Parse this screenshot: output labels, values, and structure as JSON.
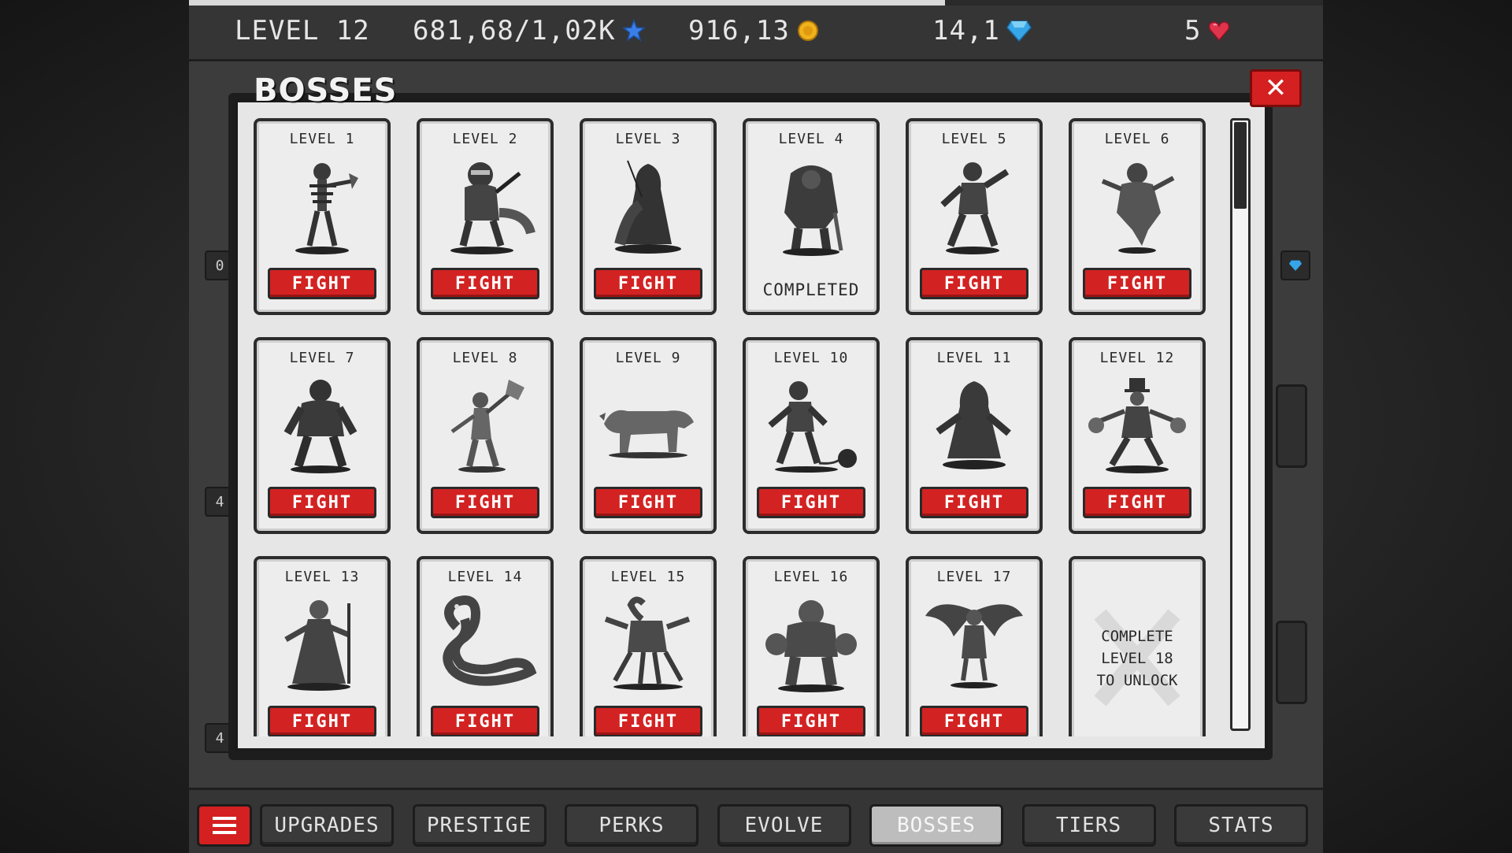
{
  "xp_progress": 0.667,
  "top_bar": {
    "level": "LEVEL 12",
    "xp": "681,68/1,02K",
    "xp_icon": "blue-star-icon",
    "gold": "916,13",
    "gold_icon": "gold-coin-icon",
    "gems": "14,1",
    "gems_icon": "blue-gem-icon",
    "rubies": "5",
    "rubies_icon": "red-heart-gem-icon"
  },
  "panel": {
    "title": "BOSSES",
    "close_label": "✕",
    "side_counters": [
      "0",
      "4",
      "4"
    ]
  },
  "bosses": [
    {
      "level": "LEVEL 1",
      "figure": "skeleton-with-axe",
      "state": "fight",
      "action": "FIGHT"
    },
    {
      "level": "LEVEL 2",
      "figure": "raccoon-warrior",
      "state": "fight",
      "action": "FIGHT"
    },
    {
      "level": "LEVEL 3",
      "figure": "hooded-assassin",
      "state": "fight",
      "action": "FIGHT"
    },
    {
      "level": "LEVEL 4",
      "figure": "armored-ogre",
      "state": "completed",
      "action": "COMPLETED"
    },
    {
      "level": "LEVEL 5",
      "figure": "fighter",
      "state": "fight",
      "action": "FIGHT"
    },
    {
      "level": "LEVEL 6",
      "figure": "wraith",
      "state": "fight",
      "action": "FIGHT"
    },
    {
      "level": "LEVEL 7",
      "figure": "hooded-brute",
      "state": "fight",
      "action": "FIGHT"
    },
    {
      "level": "LEVEL 8",
      "figure": "axe-wielder",
      "state": "fight",
      "action": "FIGHT"
    },
    {
      "level": "LEVEL 9",
      "figure": "wolf",
      "state": "fight",
      "action": "FIGHT"
    },
    {
      "level": "LEVEL 10",
      "figure": "ball-and-chain-prisoner",
      "state": "fight",
      "action": "FIGHT"
    },
    {
      "level": "LEVEL 11",
      "figure": "hooded-crone",
      "state": "fight",
      "action": "FIGHT"
    },
    {
      "level": "LEVEL 12",
      "figure": "top-hat-magician",
      "state": "fight",
      "action": "FIGHT"
    },
    {
      "level": "LEVEL 13",
      "figure": "robed-witch",
      "state": "fight",
      "action": "FIGHT"
    },
    {
      "level": "LEVEL 14",
      "figure": "serpent",
      "state": "fight",
      "action": "FIGHT"
    },
    {
      "level": "LEVEL 15",
      "figure": "scorpion-beast",
      "state": "fight",
      "action": "FIGHT"
    },
    {
      "level": "LEVEL 16",
      "figure": "stone-golem",
      "state": "fight",
      "action": "FIGHT"
    },
    {
      "level": "LEVEL 17",
      "figure": "winged-demon",
      "state": "fight",
      "action": "FIGHT"
    },
    {
      "level": "",
      "figure": "locked-silhouette",
      "state": "locked",
      "action": "COMPLETE\nLEVEL 18\nTO UNLOCK"
    }
  ],
  "nav": {
    "menu_icon": "hamburger-menu-icon",
    "tabs": [
      {
        "label": "UPGRADES",
        "active": false
      },
      {
        "label": "PRESTIGE",
        "active": false
      },
      {
        "label": "PERKS",
        "active": false
      },
      {
        "label": "EVOLVE",
        "active": false
      },
      {
        "label": "BOSSES",
        "active": true
      },
      {
        "label": "TIERS",
        "active": false
      },
      {
        "label": "STATS",
        "active": false
      }
    ]
  },
  "colors": {
    "accent_red": "#d42020",
    "card_bg": "#ededed",
    "frame_dark": "#1b1b1b",
    "ui_gray": "#3c3c3c"
  }
}
